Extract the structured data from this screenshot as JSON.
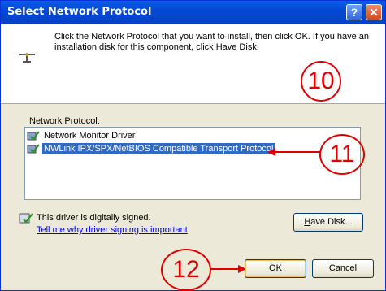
{
  "window": {
    "title": "Select Network Protocol",
    "help_glyph": "?",
    "close_glyph": "✕"
  },
  "instructions": "Click the Network Protocol that you want to install, then click OK. If you have an installation disk for this component, click Have Disk.",
  "list": {
    "label": "Network Protocol:",
    "items": [
      {
        "label": "Network Monitor Driver",
        "selected": false
      },
      {
        "label": "NWLink IPX/SPX/NetBIOS Compatible Transport Protocol",
        "selected": true
      }
    ]
  },
  "signature": {
    "status": "This driver is digitally signed.",
    "link": "Tell me why driver signing is important"
  },
  "buttons": {
    "have_disk_prefix": "H",
    "have_disk_rest": "ave Disk...",
    "ok": "OK",
    "cancel": "Cancel"
  },
  "callouts": {
    "step10": "10",
    "step11": "11",
    "step12": "12"
  },
  "colors": {
    "titlebar": "#0543c4",
    "selection": "#316ac5",
    "annotation": "#e00000"
  }
}
